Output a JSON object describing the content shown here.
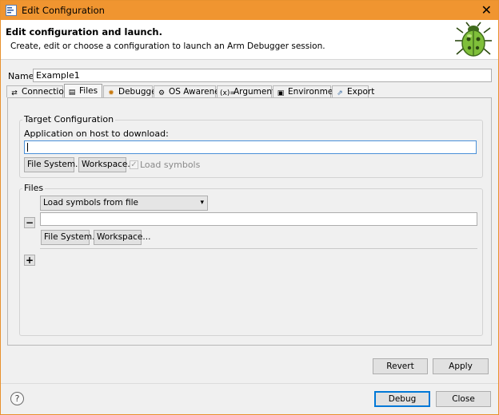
{
  "window": {
    "title": "Edit Configuration",
    "close_glyph": "✕"
  },
  "banner": {
    "title": "Edit configuration and launch.",
    "subtitle": "Create, edit or choose a configuration to launch an Arm Debugger session.",
    "icon": "bug-icon"
  },
  "name_field": {
    "label": "Name:",
    "value": "Example1"
  },
  "tabs": [
    {
      "label": "Connection",
      "icon": "connection-icon",
      "active": false
    },
    {
      "label": "Files",
      "icon": "files-icon",
      "active": true
    },
    {
      "label": "Debugger",
      "icon": "debugger-icon",
      "active": false
    },
    {
      "label": "OS Awareness",
      "icon": "os-awareness-icon",
      "active": false
    },
    {
      "label": "Arguments",
      "icon": "arguments-icon",
      "active": false
    },
    {
      "label": "Environment",
      "icon": "environment-icon",
      "active": false
    },
    {
      "label": "Export",
      "icon": "export-icon",
      "active": false
    }
  ],
  "target": {
    "group_label": "Target Configuration",
    "app_label": "Application on host to download:",
    "app_value": "",
    "filesystem_label": "File System...",
    "workspace_label": "Workspace...",
    "load_symbols_label": "Load symbols",
    "load_symbols_checked": true
  },
  "files": {
    "group_label": "Files",
    "select_value": "Load symbols from file",
    "file_value": "",
    "filesystem_label": "File System...",
    "workspace_label": "Workspace...",
    "remove_glyph": "−",
    "add_glyph": "+"
  },
  "buttons": {
    "revert": "Revert",
    "apply": "Apply",
    "debug": "Debug",
    "close": "Close"
  },
  "help_glyph": "?",
  "colors": {
    "titlebar": "#f09530",
    "focus_border": "#4a90d9",
    "default_button_border": "#0078d7"
  }
}
